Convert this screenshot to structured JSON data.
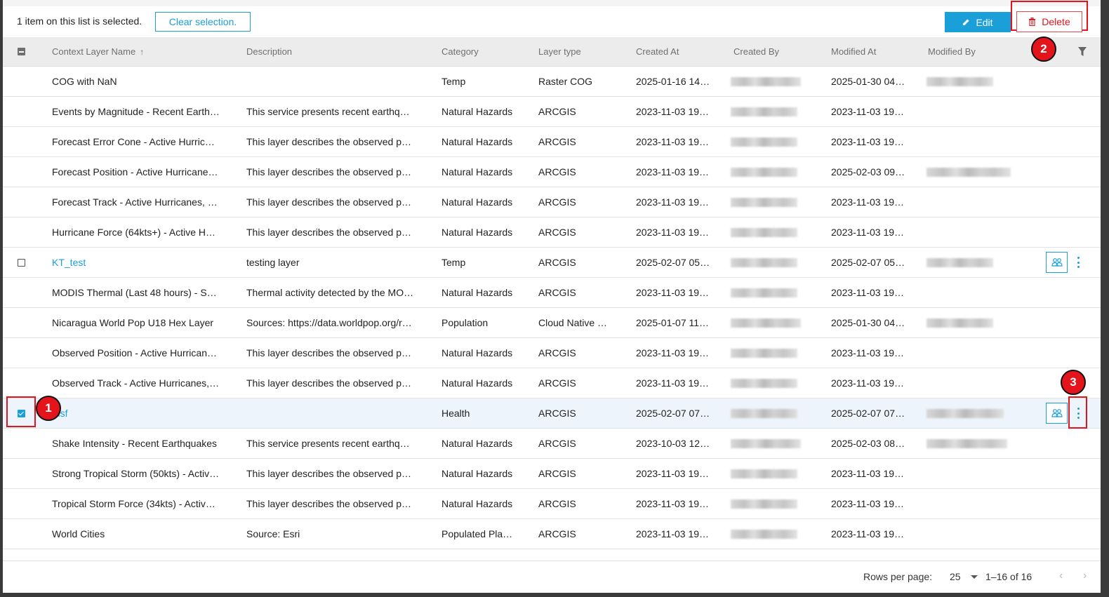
{
  "toolbar": {
    "selection_text": "1 item on this list is selected.",
    "clear_label": "Clear selection.",
    "edit_label": "Edit",
    "delete_label": "Delete"
  },
  "columns": {
    "name": "Context Layer Name",
    "description": "Description",
    "category": "Category",
    "layer_type": "Layer type",
    "created_at": "Created At",
    "created_by": "Created By",
    "modified_at": "Modified At",
    "modified_by": "Modified By"
  },
  "rows": [
    {
      "name": "COG with NaN",
      "description": "",
      "category": "Temp",
      "layer_type": "Raster COG",
      "created_at": "2025-01-16 14…",
      "modified_at": "2025-01-30 04…",
      "link": false,
      "checkbox": false,
      "checked": false,
      "actions": false
    },
    {
      "name": "Events by Magnitude - Recent Earth…",
      "description": "This service presents recent earthq…",
      "category": "Natural Hazards",
      "layer_type": "ARCGIS",
      "created_at": "2023-11-03 19…",
      "modified_at": "2023-11-03 19…",
      "link": false,
      "checkbox": false,
      "checked": false,
      "actions": false
    },
    {
      "name": "Forecast Error Cone - Active Hurric…",
      "description": "This layer describes the observed p…",
      "category": "Natural Hazards",
      "layer_type": "ARCGIS",
      "created_at": "2023-11-03 19…",
      "modified_at": "2023-11-03 19…",
      "link": false,
      "checkbox": false,
      "checked": false,
      "actions": false
    },
    {
      "name": "Forecast Position - Active Hurricane…",
      "description": "This layer describes the observed p…",
      "category": "Natural Hazards",
      "layer_type": "ARCGIS",
      "created_at": "2023-11-03 19…",
      "modified_at": "2025-02-03 09…",
      "link": false,
      "checkbox": false,
      "checked": false,
      "actions": false
    },
    {
      "name": "Forecast Track - Active Hurricanes, …",
      "description": "This layer describes the observed p…",
      "category": "Natural Hazards",
      "layer_type": "ARCGIS",
      "created_at": "2023-11-03 19…",
      "modified_at": "2023-11-03 19…",
      "link": false,
      "checkbox": false,
      "checked": false,
      "actions": false
    },
    {
      "name": "Hurricane Force (64kts+) - Active H…",
      "description": "This layer describes the observed p…",
      "category": "Natural Hazards",
      "layer_type": "ARCGIS",
      "created_at": "2023-11-03 19…",
      "modified_at": "2023-11-03 19…",
      "link": false,
      "checkbox": false,
      "checked": false,
      "actions": false
    },
    {
      "name": "KT_test",
      "description": "testing layer",
      "category": "Temp",
      "layer_type": "ARCGIS",
      "created_at": "2025-02-07 05…",
      "modified_at": "2025-02-07 05…",
      "link": true,
      "checkbox": true,
      "checked": false,
      "actions": true
    },
    {
      "name": "MODIS Thermal (Last 48 hours) - S…",
      "description": "Thermal activity detected by the MO…",
      "category": "Natural Hazards",
      "layer_type": "ARCGIS",
      "created_at": "2023-11-03 19…",
      "modified_at": "2023-11-03 19…",
      "link": false,
      "checkbox": false,
      "checked": false,
      "actions": false
    },
    {
      "name": "Nicaragua World Pop U18 Hex Layer",
      "description": "Sources: https://data.worldpop.org/r…",
      "category": "Population",
      "layer_type": "Cloud Native …",
      "created_at": "2025-01-07 11…",
      "modified_at": "2025-01-30 04…",
      "link": false,
      "checkbox": false,
      "checked": false,
      "actions": false
    },
    {
      "name": "Observed Position - Active Hurrican…",
      "description": "This layer describes the observed p…",
      "category": "Natural Hazards",
      "layer_type": "ARCGIS",
      "created_at": "2023-11-03 19…",
      "modified_at": "2023-11-03 19…",
      "link": false,
      "checkbox": false,
      "checked": false,
      "actions": false
    },
    {
      "name": "Observed Track - Active Hurricanes,…",
      "description": "This layer describes the observed p…",
      "category": "Natural Hazards",
      "layer_type": "ARCGIS",
      "created_at": "2023-11-03 19…",
      "modified_at": "2023-11-03 19…",
      "link": false,
      "checkbox": false,
      "checked": false,
      "actions": false
    },
    {
      "name": "fdsf",
      "description": "",
      "category": "Health",
      "layer_type": "ARCGIS",
      "created_at": "2025-02-07 07…",
      "modified_at": "2025-02-07 07…",
      "link": true,
      "checkbox": true,
      "checked": true,
      "actions": true
    },
    {
      "name": "Shake Intensity - Recent Earthquakes",
      "description": "This service presents recent earthq…",
      "category": "Natural Hazards",
      "layer_type": "ARCGIS",
      "created_at": "2023-10-03 12…",
      "modified_at": "2025-02-03 08…",
      "link": false,
      "checkbox": false,
      "checked": false,
      "actions": false
    },
    {
      "name": "Strong Tropical Storm (50kts) - Activ…",
      "description": "This layer describes the observed p…",
      "category": "Natural Hazards",
      "layer_type": "ARCGIS",
      "created_at": "2023-11-03 19…",
      "modified_at": "2023-11-03 19…",
      "link": false,
      "checkbox": false,
      "checked": false,
      "actions": false
    },
    {
      "name": "Tropical Storm Force (34kts) - Activ…",
      "description": "This layer describes the observed p…",
      "category": "Natural Hazards",
      "layer_type": "ARCGIS",
      "created_at": "2023-11-03 19…",
      "modified_at": "2023-11-03 19…",
      "link": false,
      "checkbox": false,
      "checked": false,
      "actions": false
    },
    {
      "name": "World Cities",
      "description": "Source: Esri",
      "category": "Populated Pla…",
      "layer_type": "ARCGIS",
      "created_at": "2023-11-03 19…",
      "modified_at": "2023-11-03 19…",
      "link": false,
      "checkbox": false,
      "checked": false,
      "actions": false
    }
  ],
  "footer": {
    "rows_per_page_label": "Rows per page:",
    "rows_per_page_value": "25",
    "range_text": "1–16 of 16"
  },
  "annotations": [
    "1",
    "2",
    "3"
  ],
  "colors": {
    "accent": "#1a9fd9",
    "danger": "#e3141b"
  }
}
